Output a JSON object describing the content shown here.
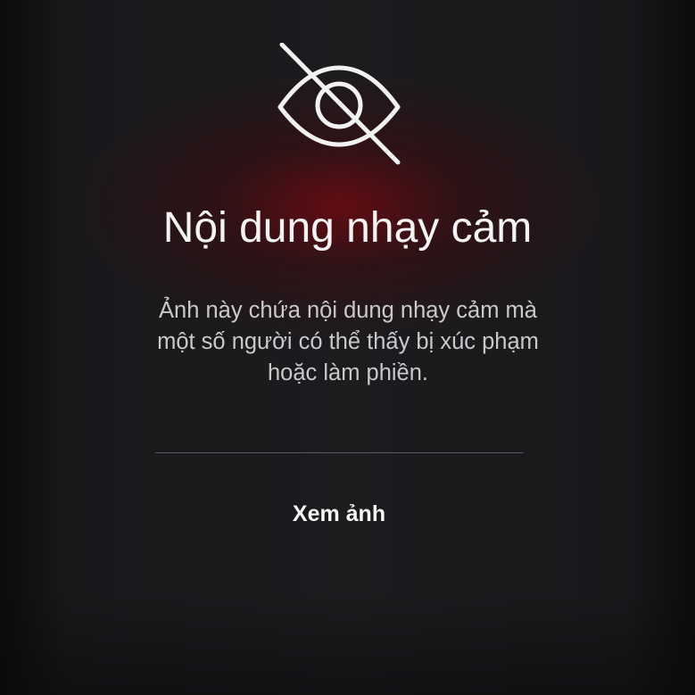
{
  "warning": {
    "icon": "eye-slash-icon",
    "title": "Nội dung nhạy cảm",
    "description_lines": [
      "Ảnh này chứa nội dung nhạy cảm mà",
      "một số người có thể thấy bị xúc phạm",
      "hoặc làm phiền."
    ],
    "view_button_label": "Xem ảnh"
  },
  "colors": {
    "background": "#1c1b1e",
    "glow": "#6e0a10",
    "text": "#f3f3f3",
    "secondary_text": "#c9c9cb",
    "divider": "#5a5a5e"
  }
}
